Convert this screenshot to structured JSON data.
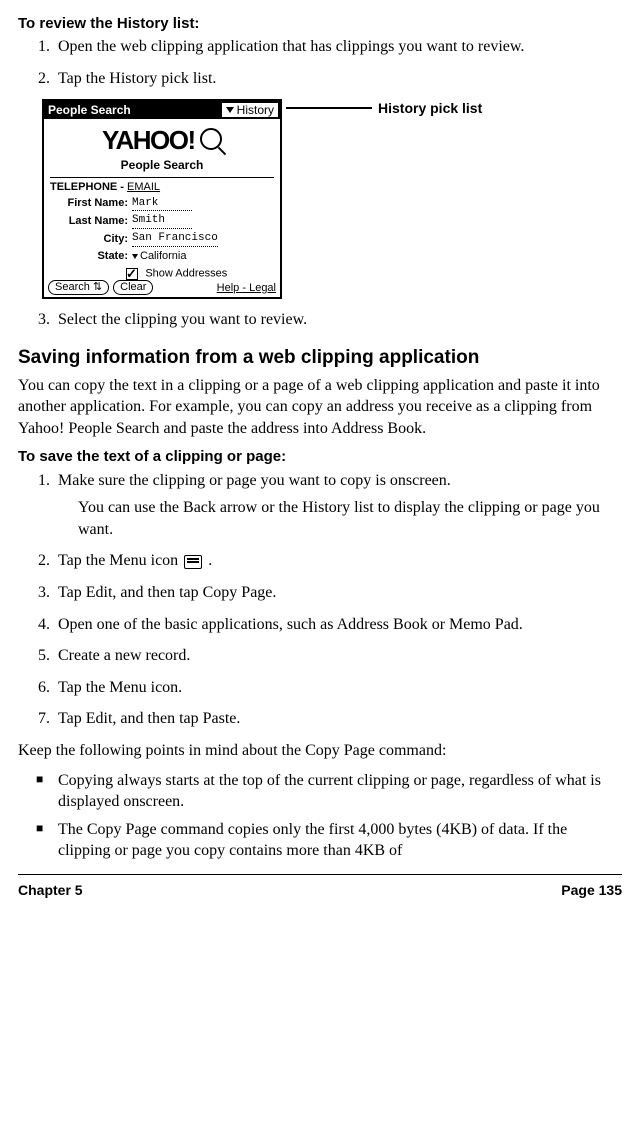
{
  "headings": {
    "reviewHistory": "To review the History list:",
    "savingInfo": "Saving information from a web clipping application",
    "toSaveText": "To save the text of a clipping or page:"
  },
  "listA": {
    "item1": "Open the web clipping application that has clippings you want to review.",
    "item2": "Tap the History pick list.",
    "item3": "Select the clipping you want to review."
  },
  "screenshot": {
    "titleLeft": "People Search",
    "titleRight": "History",
    "logo": "YAHOO!",
    "logoSub": "People Search",
    "tele": "TELEPHONE",
    "email": "EMAIL",
    "firstLabel": "First   Name:",
    "firstVal": "Mark",
    "lastLabel": "Last   Name:",
    "lastVal": "Smith",
    "cityLabel": "City:",
    "cityVal": "San Francisco",
    "stateLabel": "State:",
    "stateVal": "California",
    "showAddresses": "Show Addresses",
    "searchBtn": "Search",
    "clearBtn": "Clear",
    "helpLink": "Help",
    "legalLink": "Legal",
    "callout": "History pick list"
  },
  "paraSaving": "You can copy the text in a clipping or a page of a web clipping application and paste it into another application. For example, you can copy an address you receive as a clipping from Yahoo! People Search and paste the address into Address Book.",
  "listB": {
    "item1": "Make sure the clipping or page you want to copy is onscreen.",
    "item1note": "You can use the Back arrow or the History list to display the clipping or page you want.",
    "item2a": "Tap the Menu icon ",
    "item2b": " .",
    "item3": "Tap Edit, and then tap Copy Page.",
    "item4": "Open one of the basic applications, such as Address Book or Memo Pad.",
    "item5": "Create a new record.",
    "item6": "Tap the Menu icon.",
    "item7": "Tap Edit, and then tap Paste."
  },
  "paraKeep": "Keep the following points in mind about the Copy Page command:",
  "bullets": {
    "b1": "Copying always starts at the top of the current clipping or page, regardless of what is displayed onscreen.",
    "b2": "The Copy Page command copies only the first 4,000 bytes (4KB) of data. If the clipping or page you copy contains more than 4KB of"
  },
  "footer": {
    "left": "Chapter 5",
    "right": "Page 135"
  }
}
